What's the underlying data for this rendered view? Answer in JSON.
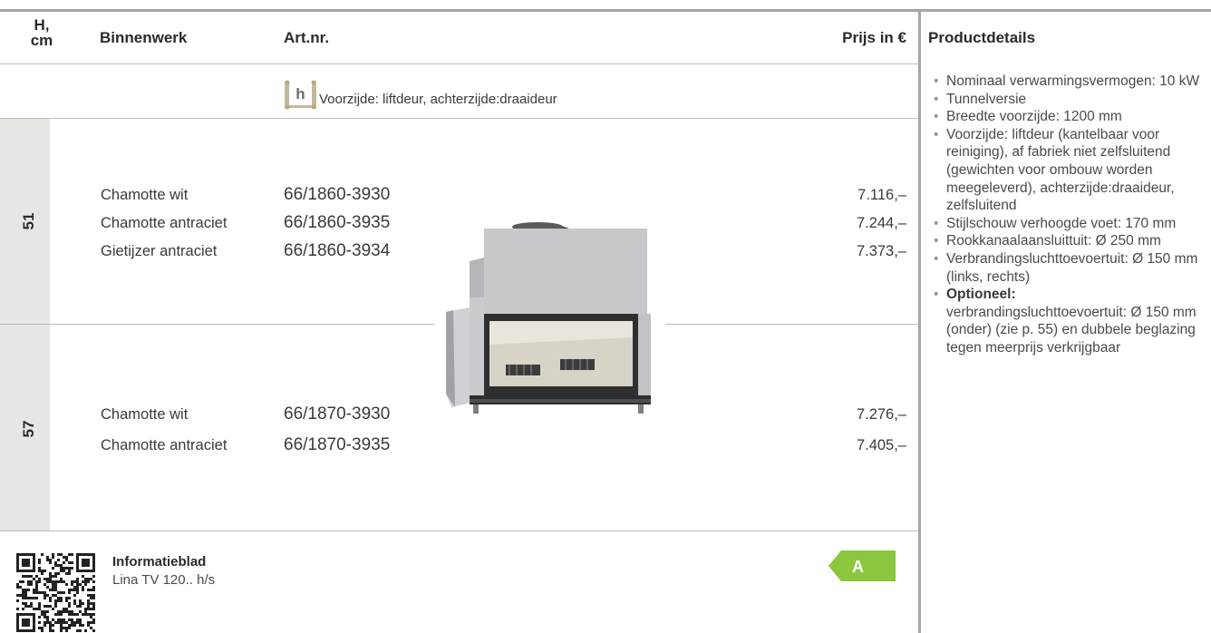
{
  "header": {
    "height_label": "H,\ncm",
    "binnenwerk": "Binnenwerk",
    "artnr": "Art.nr.",
    "price": "Prijs in €",
    "details": "Productdetails"
  },
  "door_info": {
    "icon_letter": "h",
    "text": "Voorzijde: liftdeur, achterzijde:draaideur"
  },
  "groups": [
    {
      "height": "51",
      "rows": [
        {
          "binnenwerk": "Chamotte wit",
          "artnr": "66/1860-3930",
          "price": "7.116,–"
        },
        {
          "binnenwerk": "Chamotte antraciet",
          "artnr": "66/1860-3935",
          "price": "7.244,–"
        },
        {
          "binnenwerk": "Gietijzer antraciet",
          "artnr": "66/1860-3934",
          "price": "7.373,–"
        }
      ]
    },
    {
      "height": "57",
      "rows": [
        {
          "binnenwerk": "Chamotte wit",
          "artnr": "66/1870-3930",
          "price": "7.276,–"
        },
        {
          "binnenwerk": "Chamotte antraciet",
          "artnr": "66/1870-3935",
          "price": "7.405,–"
        }
      ]
    }
  ],
  "details": [
    "Nominaal verwarmingsvermogen: 10 kW",
    "Tunnelversie",
    "Breedte voorzijde: 1200 mm",
    "Voorzijde: liftdeur (kantelbaar voor reiniging), af fabriek niet zelfsluitend (gewichten voor ombouw worden meegeleverd), achterzijde:draaideur, zelfsluitend",
    "Stijlschouw verhoogde voet: 170 mm",
    "Rookkanaalaansluittuit: Ø 250 mm",
    "Verbrandingsluchttoevoertuit: Ø 150 mm (links, rechts)"
  ],
  "details_optional": {
    "label": "Optioneel:",
    "text": "verbrandingsluchttoevoertuit: Ø 150 mm (onder) (zie p. 55) en dubbele beglazing tegen meerprijs verkrijgbaar"
  },
  "footer": {
    "info_title": "Informatieblad",
    "info_sub": "Lina TV 120.. h/s",
    "energy_class": "A"
  },
  "colors": {
    "energy_green": "#8cc63f",
    "band": "#e8e6e2",
    "rule": "#a6a6a6"
  }
}
